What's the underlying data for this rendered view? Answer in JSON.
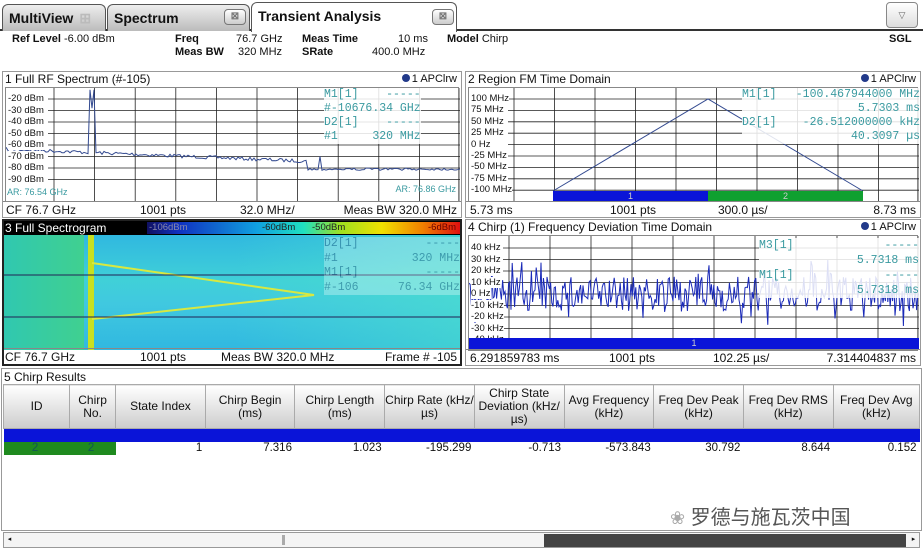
{
  "tabs": [
    {
      "label": "MultiView",
      "icon": "grid-icon"
    },
    {
      "label": "Spectrum",
      "close": "close-icon"
    },
    {
      "label": "Transient Analysis",
      "close": "close-icon",
      "active": true
    }
  ],
  "header": {
    "ref_level_label": "Ref Level",
    "ref_level": "-6.00 dBm",
    "freq_label": "Freq",
    "freq": "76.7 GHz",
    "meas_bw_label": "Meas BW",
    "meas_bw": "320 MHz",
    "meas_time_label": "Meas Time",
    "meas_time": "10 ms",
    "srate_label": "SRate",
    "srate": "400.0 MHz",
    "model_label": "Model",
    "model": "Chirp",
    "sweep_mode": "SGL"
  },
  "panel1": {
    "title": "1 Full RF Spectrum (#-105)",
    "trace": "1 APClrw",
    "yticks": [
      "-20 dBm",
      "-30 dBm",
      "-40 dBm",
      "-50 dBm",
      "-60 dBm",
      "-70 dBm",
      "-80 dBm",
      "-90 dBm"
    ],
    "markers": [
      [
        "M1[1]",
        "-----"
      ],
      [
        "#-106",
        "76.34 GHz"
      ],
      [
        "D2[1]",
        "-----"
      ],
      [
        "#1",
        "320 MHz"
      ]
    ],
    "ar_left": "AR: 76.54 GHz",
    "ar_right": "AR: 76.86 GHz",
    "footer": [
      "CF 76.7 GHz",
      "1001 pts",
      "32.0 MHz/",
      "Meas BW 320.0 MHz"
    ]
  },
  "panel2": {
    "title": "2 Region FM Time Domain",
    "trace": "1 APClrw",
    "yticks": [
      "100 MHz",
      "75 MHz",
      "50 MHz",
      "25 MHz",
      "0 Hz",
      "-25 MHz",
      "-50 MHz",
      "-75 MHz",
      "-100 MHz"
    ],
    "markers": [
      [
        "M1[1]",
        "-100.467944000 MHz"
      ],
      [
        "",
        "5.7303 ms"
      ],
      [
        "D2[1]",
        "-26.512000000 kHz"
      ],
      [
        "",
        "40.3097 µs"
      ]
    ],
    "regions": [
      "1",
      "2"
    ],
    "region_colors": [
      "#0a14d8",
      "#10a030"
    ],
    "footer": [
      "5.73 ms",
      "1001 pts",
      "300.0 µs/",
      "8.73 ms"
    ]
  },
  "panel3": {
    "title": "3 Full Spectrogram",
    "colorbar": [
      "-106dBm",
      "-60dBm",
      "-50dBm",
      "-6dBm"
    ],
    "markers": [
      [
        "D2[1]",
        "-----"
      ],
      [
        "#1",
        "320 MHz"
      ],
      [
        "M1[1]",
        "-----"
      ],
      [
        "#-106",
        "76.34 GHz"
      ]
    ],
    "footer": [
      "CF 76.7 GHz",
      "1001 pts",
      "Meas BW 320.0 MHz",
      "Frame # -105"
    ]
  },
  "panel4": {
    "title": "4 Chirp (1) Frequency Deviation Time Domain",
    "trace": "1 APClrw",
    "yticks": [
      "40 kHz",
      "30 kHz",
      "20 kHz",
      "10 kHz",
      "0 Hz",
      "-10 kHz",
      "-20 kHz",
      "-30 kHz",
      "-40 kHz"
    ],
    "markers": [
      [
        "M3[1]",
        "-----"
      ],
      [
        "",
        "5.7318 ms"
      ],
      [
        "M1[1]",
        "-----"
      ],
      [
        "",
        "5.7318 ms"
      ]
    ],
    "region": "1",
    "footer": [
      "6.291859783 ms",
      "1001 pts",
      "102.25 µs/",
      "7.314404837 ms"
    ]
  },
  "panel5": {
    "title": "5 Chirp Results",
    "columns": [
      "ID",
      "Chirp No.",
      "State Index",
      "Chirp Begin (ms)",
      "Chirp Length (ms)",
      "Chirp Rate (kHz/µs)",
      "Chirp State Deviation (kHz/µs)",
      "Avg Frequency (kHz)",
      "Freq Dev Peak (kHz)",
      "Freq Dev RMS (kHz)",
      "Freq Dev Avg (kHz)"
    ],
    "rows": [
      [
        "2",
        "2",
        "1",
        "7.316",
        "1.023",
        "-195.299",
        "-0.713",
        "-573.843",
        "30.792",
        "8.644",
        "0.152"
      ]
    ]
  },
  "watermark": "罗德与施瓦茨中国"
}
